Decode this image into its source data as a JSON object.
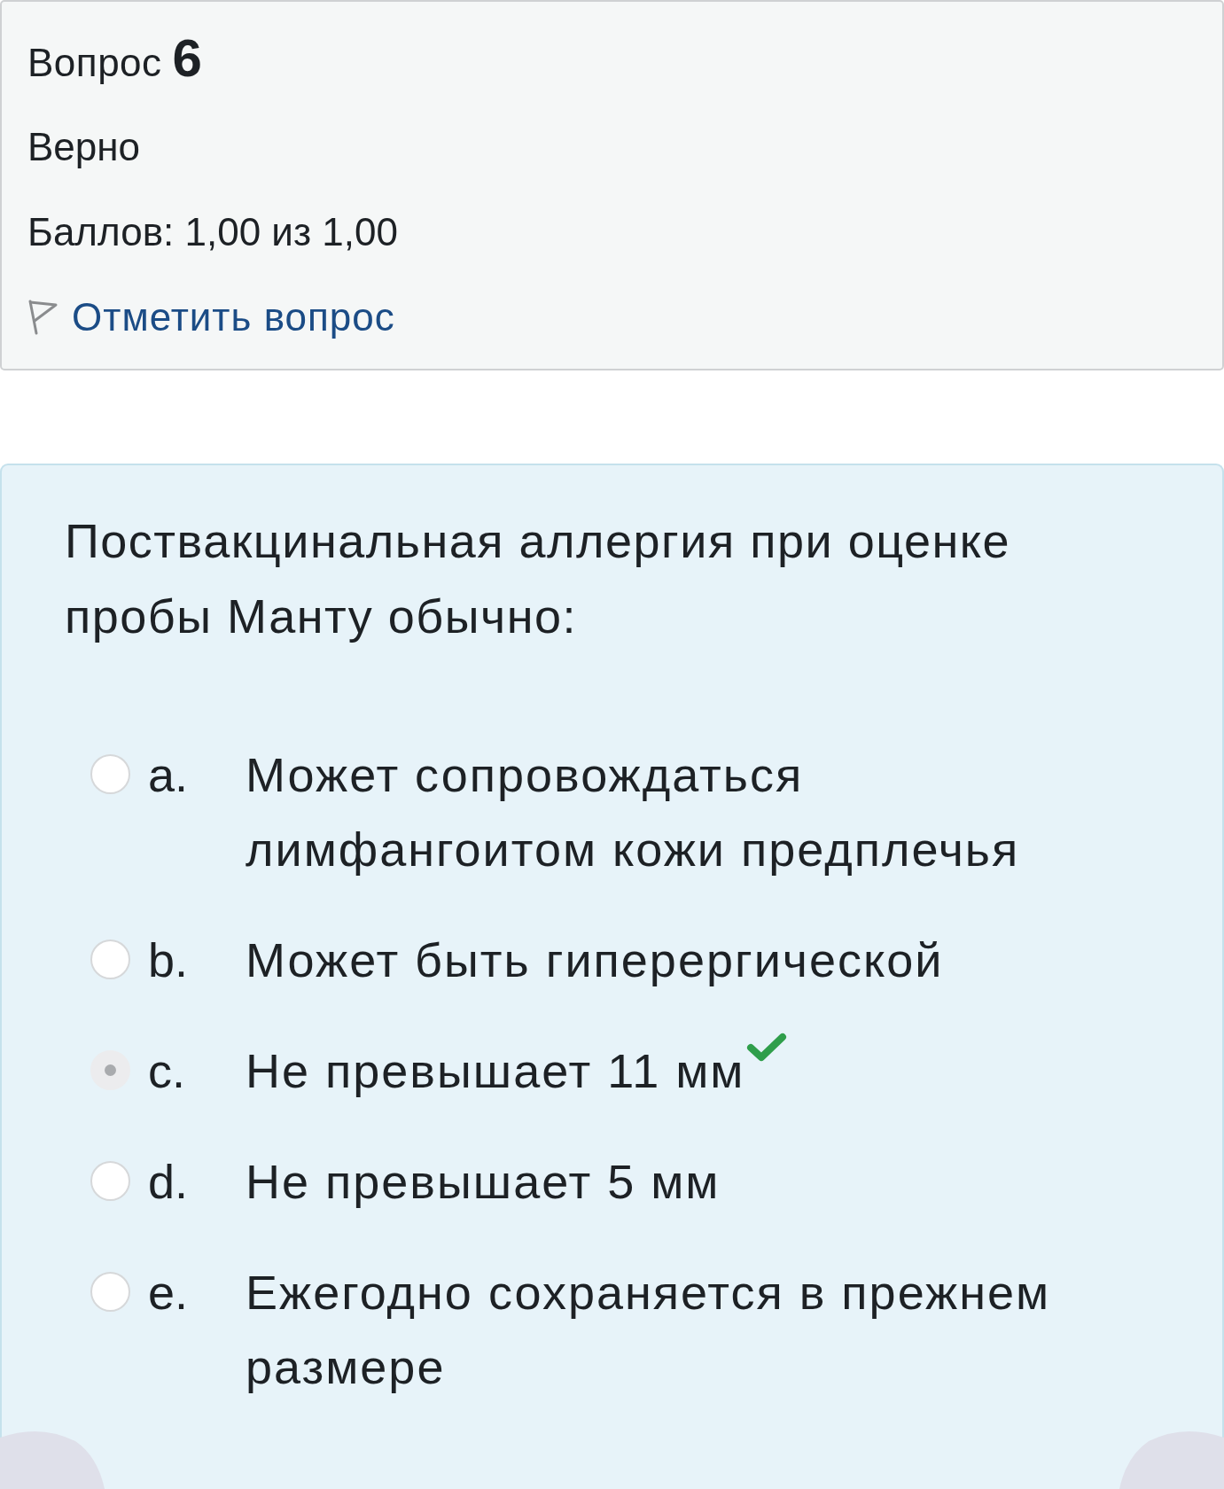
{
  "question_info": {
    "label": "Вопрос",
    "number": "6",
    "state": "Верно",
    "grade": "Баллов: 1,00 из 1,00",
    "flag_link": "Отметить вопрос"
  },
  "question": {
    "text": "Поствакцинальная аллергия при оценке пробы Манту обычно:",
    "options": [
      {
        "letter": "a.",
        "text": "Может сопровождаться лимфангоитом кожи предплечья",
        "selected": false,
        "correct": false
      },
      {
        "letter": "b.",
        "text": "Может быть гиперергической",
        "selected": false,
        "correct": false
      },
      {
        "letter": "c.",
        "text": "Не превышает 11 мм",
        "selected": true,
        "correct": true
      },
      {
        "letter": "d.",
        "text": "Не превышает 5 мм",
        "selected": false,
        "correct": false
      },
      {
        "letter": "e.",
        "text": "Ежегодно сохраняется в прежнем размере",
        "selected": false,
        "correct": false
      }
    ]
  }
}
